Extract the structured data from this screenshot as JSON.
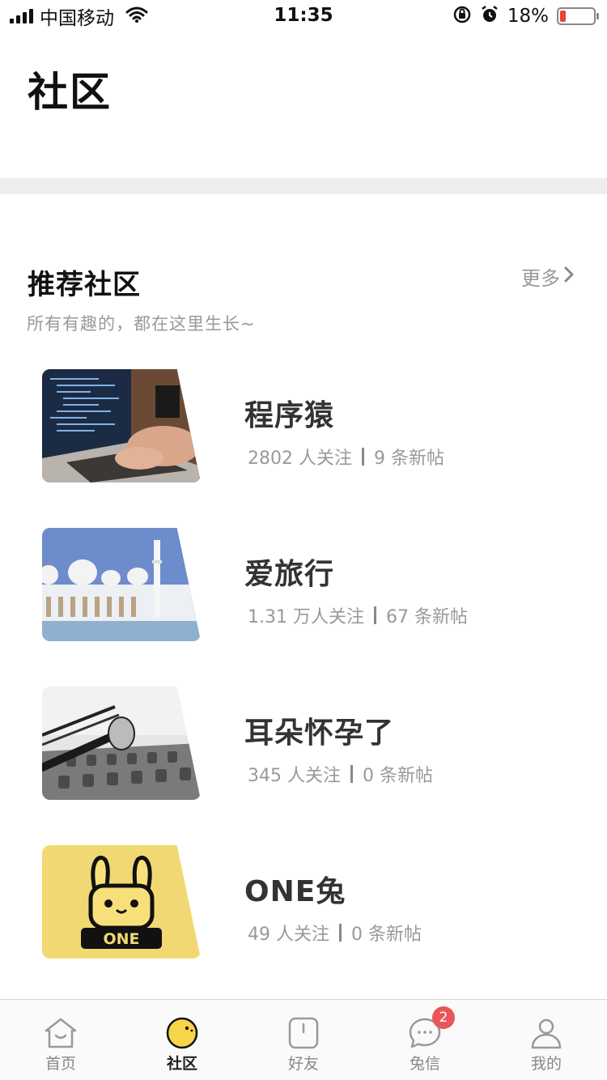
{
  "status_bar": {
    "carrier": "中国移动",
    "time": "11:35",
    "battery_percent": "18%",
    "battery_level": 0.18
  },
  "header": {
    "title": "社区"
  },
  "recommended": {
    "title": "推荐社区",
    "more_label": "更多",
    "subtitle": "所有有趣的，都在这里生长~",
    "items": [
      {
        "name": "程序猿",
        "followers": "2802 人关注",
        "posts": "9 条新帖",
        "image_icon": "laptop-code-photo"
      },
      {
        "name": "爱旅行",
        "followers": "1.31 万人关注",
        "posts": "67 条新帖",
        "image_icon": "mosque-photo"
      },
      {
        "name": "耳朵怀孕了",
        "followers": "345 人关注",
        "posts": "0 条新帖",
        "image_icon": "microphone-photo"
      },
      {
        "name": "ONE兔",
        "followers": "49 人关注",
        "posts": "0 条新帖",
        "image_icon": "one-rabbit-logo"
      }
    ]
  },
  "tab_bar": {
    "tabs": [
      {
        "label": "首页",
        "icon": "home-icon"
      },
      {
        "label": "社区",
        "icon": "community-icon",
        "active": true
      },
      {
        "label": "好友",
        "icon": "friends-icon"
      },
      {
        "label": "兔信",
        "icon": "message-icon",
        "badge": "2"
      },
      {
        "label": "我的",
        "icon": "profile-icon"
      }
    ]
  },
  "colors": {
    "accent_yellow": "#f7d548",
    "badge_red": "#e9555a",
    "battery_red": "#e4453a"
  }
}
